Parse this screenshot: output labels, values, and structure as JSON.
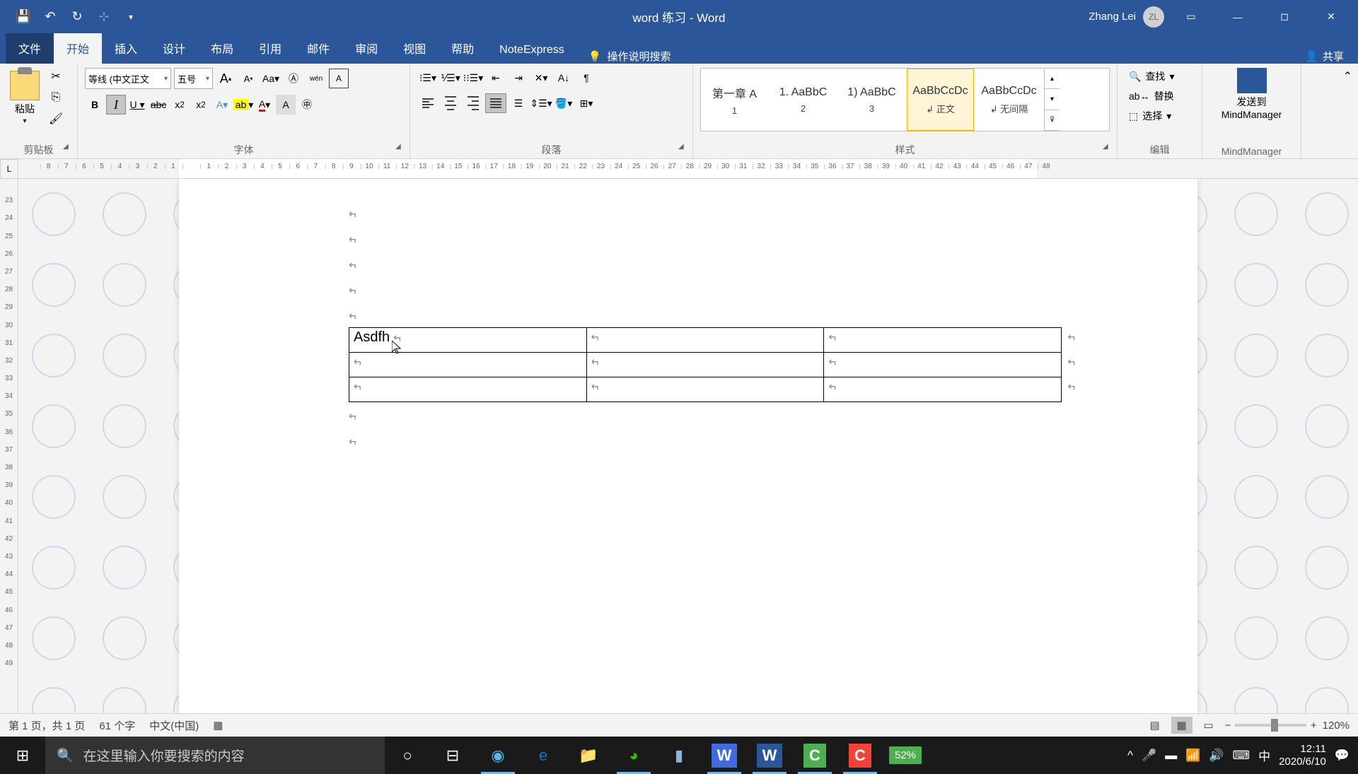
{
  "title": "word 练习  -  Word",
  "user": {
    "name": "Zhang Lei",
    "initials": "ZL"
  },
  "qat": {
    "save": "保存",
    "undo": "撤销",
    "redo": "重做"
  },
  "tabs": {
    "file": "文件",
    "home": "开始",
    "insert": "插入",
    "design": "设计",
    "layout": "布局",
    "references": "引用",
    "mailings": "邮件",
    "review": "审阅",
    "view": "视图",
    "help": "帮助",
    "noteexpress": "NoteExpress",
    "tellme": "操作说明搜索"
  },
  "share": "共享",
  "ribbon": {
    "clipboard": {
      "label": "剪贴板",
      "paste": "粘贴"
    },
    "font": {
      "label": "字体",
      "name": "等线 (中文正文",
      "size": "五号"
    },
    "paragraph": {
      "label": "段落"
    },
    "styles": {
      "label": "样式",
      "items": [
        {
          "preview": "第一章 A",
          "name": "1"
        },
        {
          "preview": "1. AaBbC",
          "name": "2"
        },
        {
          "preview": "1) AaBbC",
          "name": "3"
        },
        {
          "preview": "AaBbCcDc",
          "name": "↲ 正文"
        },
        {
          "preview": "AaBbCcDc",
          "name": "↲ 无间隔"
        }
      ]
    },
    "editing": {
      "label": "编辑",
      "find": "查找",
      "replace": "替换",
      "select": "选择"
    },
    "mm": {
      "label": "MindManager",
      "button": "发送到\nMindManager"
    }
  },
  "document": {
    "cell_text": "Asdfh",
    "para_mark": "↵"
  },
  "status": {
    "page": "第 1 页，共 1 页",
    "words": "61 个字",
    "lang": "中文(中国)",
    "zoom": "120%"
  },
  "taskbar": {
    "search_placeholder": "在这里输入你要搜索的内容",
    "battery": "52%",
    "ime": "中",
    "time": "12:11",
    "date": "2020/6/10"
  }
}
